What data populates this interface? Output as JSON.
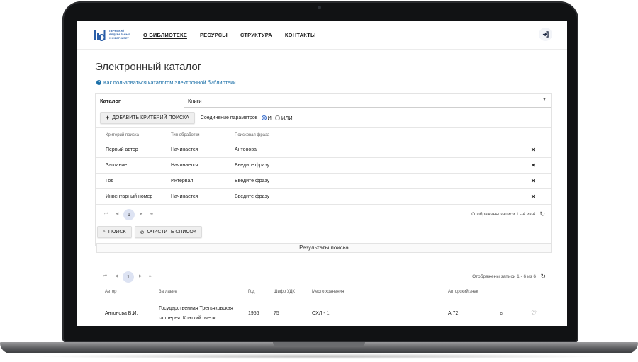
{
  "header": {
    "logo_text": "ПЕРМСКИЙ ФЕДЕРАЛЬНЫЙ УНИВЕРСИТЕТ",
    "nav": [
      {
        "label": "О БИБЛИОТЕКЕ"
      },
      {
        "label": "РЕСУРСЫ"
      },
      {
        "label": "СТРУКТУРА"
      },
      {
        "label": "КОНТАКТЫ"
      }
    ],
    "login_icon": "login-icon"
  },
  "page": {
    "title": "Электронный каталог",
    "help_link": "Как пользоваться каталогом электронной библиотеки"
  },
  "search": {
    "catalog_label": "Каталог",
    "catalog_value": "Книги",
    "add_criterion_label": "ДОБАВИТЬ КРИТЕРИЙ ПОИСКА",
    "join_label": "Соединение параметров",
    "join_options": [
      "И",
      "ИЛИ"
    ],
    "join_selected": "И",
    "columns": [
      "Критерий поиска",
      "Тип обработки",
      "Поисковая фраза"
    ],
    "rows": [
      {
        "criterion": "Первый автор",
        "type": "Начинается",
        "phrase": "Антонова"
      },
      {
        "criterion": "Заглавие",
        "type": "Начинается",
        "phrase": "Введите фразу"
      },
      {
        "criterion": "Год",
        "type": "Интервал",
        "phrase": "Введите фразу"
      },
      {
        "criterion": "Инвентарный номер",
        "type": "Начинается",
        "phrase": "Введите фразу"
      }
    ],
    "page": "1",
    "records_info": "Отображены записи 1 - 4 из 4",
    "search_button": "ПОИСК",
    "clear_button": "ОЧИСТИТЬ СПИСОК"
  },
  "results": {
    "title": "Результаты поиска",
    "page": "1",
    "records_info": "Отображены записи 1 - 6 из 6",
    "columns": [
      "Автор",
      "Заглавие",
      "Год",
      "Шифр УДК",
      "Место хранения",
      "Авторский знак"
    ],
    "rows": [
      {
        "author": "Антонова В.И.",
        "title_line1": "Государственная Третьяковская",
        "title_line2": "галлерея. Краткий очерк",
        "year": "1956",
        "udc": "75",
        "location": "ОХЛ - 1",
        "author_sign": "А 72"
      }
    ]
  }
}
